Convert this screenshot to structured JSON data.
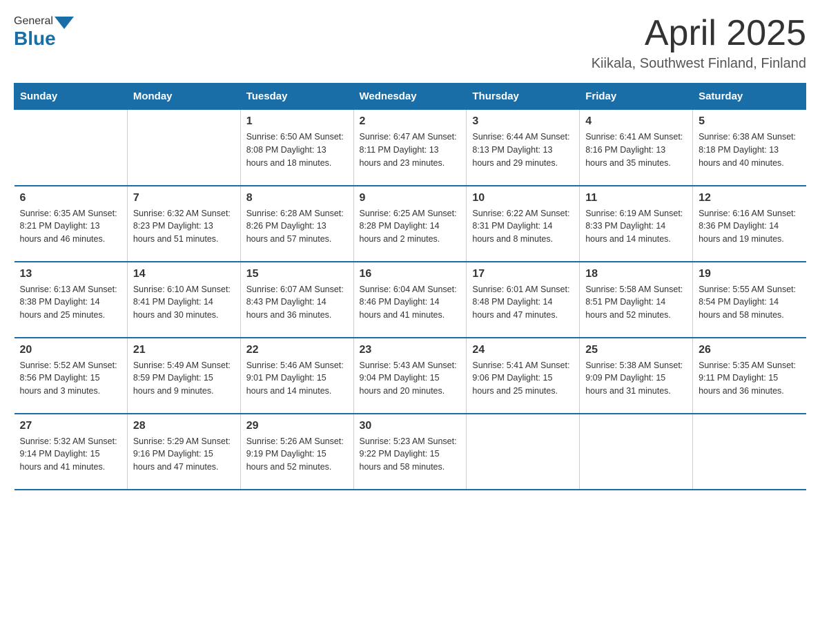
{
  "header": {
    "logo_general": "General",
    "logo_blue": "Blue",
    "title": "April 2025",
    "location": "Kiikala, Southwest Finland, Finland"
  },
  "weekdays": [
    "Sunday",
    "Monday",
    "Tuesday",
    "Wednesday",
    "Thursday",
    "Friday",
    "Saturday"
  ],
  "weeks": [
    [
      {
        "day": "",
        "info": ""
      },
      {
        "day": "",
        "info": ""
      },
      {
        "day": "1",
        "info": "Sunrise: 6:50 AM\nSunset: 8:08 PM\nDaylight: 13 hours\nand 18 minutes."
      },
      {
        "day": "2",
        "info": "Sunrise: 6:47 AM\nSunset: 8:11 PM\nDaylight: 13 hours\nand 23 minutes."
      },
      {
        "day": "3",
        "info": "Sunrise: 6:44 AM\nSunset: 8:13 PM\nDaylight: 13 hours\nand 29 minutes."
      },
      {
        "day": "4",
        "info": "Sunrise: 6:41 AM\nSunset: 8:16 PM\nDaylight: 13 hours\nand 35 minutes."
      },
      {
        "day": "5",
        "info": "Sunrise: 6:38 AM\nSunset: 8:18 PM\nDaylight: 13 hours\nand 40 minutes."
      }
    ],
    [
      {
        "day": "6",
        "info": "Sunrise: 6:35 AM\nSunset: 8:21 PM\nDaylight: 13 hours\nand 46 minutes."
      },
      {
        "day": "7",
        "info": "Sunrise: 6:32 AM\nSunset: 8:23 PM\nDaylight: 13 hours\nand 51 minutes."
      },
      {
        "day": "8",
        "info": "Sunrise: 6:28 AM\nSunset: 8:26 PM\nDaylight: 13 hours\nand 57 minutes."
      },
      {
        "day": "9",
        "info": "Sunrise: 6:25 AM\nSunset: 8:28 PM\nDaylight: 14 hours\nand 2 minutes."
      },
      {
        "day": "10",
        "info": "Sunrise: 6:22 AM\nSunset: 8:31 PM\nDaylight: 14 hours\nand 8 minutes."
      },
      {
        "day": "11",
        "info": "Sunrise: 6:19 AM\nSunset: 8:33 PM\nDaylight: 14 hours\nand 14 minutes."
      },
      {
        "day": "12",
        "info": "Sunrise: 6:16 AM\nSunset: 8:36 PM\nDaylight: 14 hours\nand 19 minutes."
      }
    ],
    [
      {
        "day": "13",
        "info": "Sunrise: 6:13 AM\nSunset: 8:38 PM\nDaylight: 14 hours\nand 25 minutes."
      },
      {
        "day": "14",
        "info": "Sunrise: 6:10 AM\nSunset: 8:41 PM\nDaylight: 14 hours\nand 30 minutes."
      },
      {
        "day": "15",
        "info": "Sunrise: 6:07 AM\nSunset: 8:43 PM\nDaylight: 14 hours\nand 36 minutes."
      },
      {
        "day": "16",
        "info": "Sunrise: 6:04 AM\nSunset: 8:46 PM\nDaylight: 14 hours\nand 41 minutes."
      },
      {
        "day": "17",
        "info": "Sunrise: 6:01 AM\nSunset: 8:48 PM\nDaylight: 14 hours\nand 47 minutes."
      },
      {
        "day": "18",
        "info": "Sunrise: 5:58 AM\nSunset: 8:51 PM\nDaylight: 14 hours\nand 52 minutes."
      },
      {
        "day": "19",
        "info": "Sunrise: 5:55 AM\nSunset: 8:54 PM\nDaylight: 14 hours\nand 58 minutes."
      }
    ],
    [
      {
        "day": "20",
        "info": "Sunrise: 5:52 AM\nSunset: 8:56 PM\nDaylight: 15 hours\nand 3 minutes."
      },
      {
        "day": "21",
        "info": "Sunrise: 5:49 AM\nSunset: 8:59 PM\nDaylight: 15 hours\nand 9 minutes."
      },
      {
        "day": "22",
        "info": "Sunrise: 5:46 AM\nSunset: 9:01 PM\nDaylight: 15 hours\nand 14 minutes."
      },
      {
        "day": "23",
        "info": "Sunrise: 5:43 AM\nSunset: 9:04 PM\nDaylight: 15 hours\nand 20 minutes."
      },
      {
        "day": "24",
        "info": "Sunrise: 5:41 AM\nSunset: 9:06 PM\nDaylight: 15 hours\nand 25 minutes."
      },
      {
        "day": "25",
        "info": "Sunrise: 5:38 AM\nSunset: 9:09 PM\nDaylight: 15 hours\nand 31 minutes."
      },
      {
        "day": "26",
        "info": "Sunrise: 5:35 AM\nSunset: 9:11 PM\nDaylight: 15 hours\nand 36 minutes."
      }
    ],
    [
      {
        "day": "27",
        "info": "Sunrise: 5:32 AM\nSunset: 9:14 PM\nDaylight: 15 hours\nand 41 minutes."
      },
      {
        "day": "28",
        "info": "Sunrise: 5:29 AM\nSunset: 9:16 PM\nDaylight: 15 hours\nand 47 minutes."
      },
      {
        "day": "29",
        "info": "Sunrise: 5:26 AM\nSunset: 9:19 PM\nDaylight: 15 hours\nand 52 minutes."
      },
      {
        "day": "30",
        "info": "Sunrise: 5:23 AM\nSunset: 9:22 PM\nDaylight: 15 hours\nand 58 minutes."
      },
      {
        "day": "",
        "info": ""
      },
      {
        "day": "",
        "info": ""
      },
      {
        "day": "",
        "info": ""
      }
    ]
  ]
}
